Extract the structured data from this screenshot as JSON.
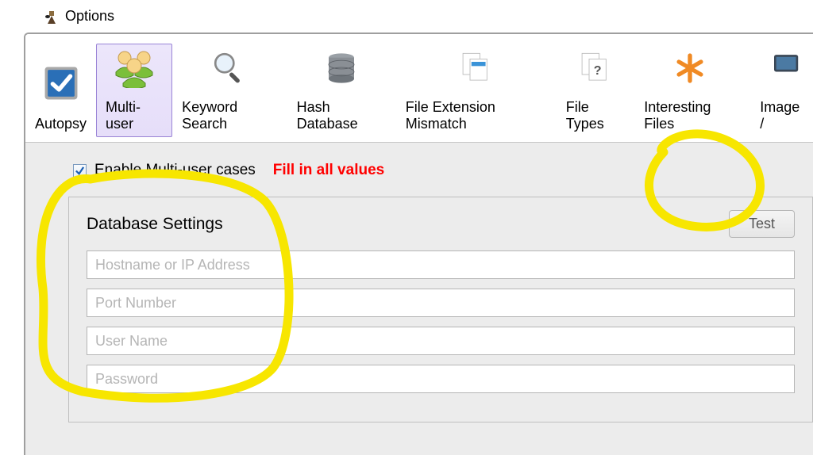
{
  "window_title": "Options",
  "toolbar": {
    "items": [
      {
        "label": "Autopsy"
      },
      {
        "label": "Multi-user",
        "selected": true
      },
      {
        "label": "Keyword Search"
      },
      {
        "label": "Hash Database"
      },
      {
        "label": "File Extension Mismatch"
      },
      {
        "label": "File Types"
      },
      {
        "label": "Interesting Files"
      },
      {
        "label": "Image /"
      }
    ]
  },
  "multiuser": {
    "enable_label": "Enable Multi-user cases",
    "enable_checked": true,
    "fill_hint": "Fill in all values",
    "database": {
      "title": "Database Settings",
      "test_label": "Test",
      "hostname_placeholder": "Hostname or IP Address",
      "port_placeholder": "Port Number",
      "username_placeholder": "User Name",
      "password_placeholder": "Password"
    }
  }
}
